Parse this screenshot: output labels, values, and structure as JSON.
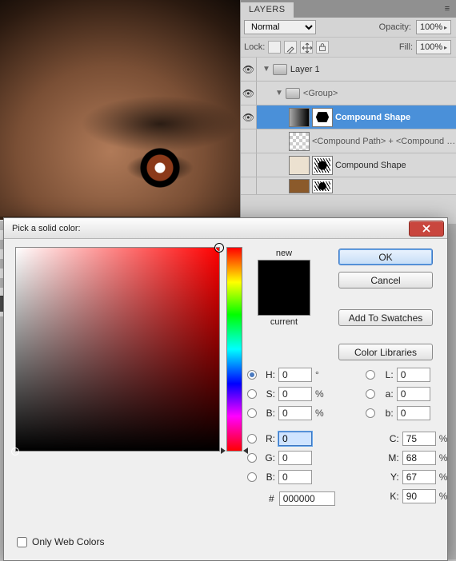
{
  "layers_panel": {
    "tab_label": "LAYERS",
    "blend_mode": "Normal",
    "opacity_label": "Opacity:",
    "opacity_value": "100%",
    "lock_label": "Lock:",
    "fill_label": "Fill:",
    "fill_value": "100%",
    "items": [
      {
        "name": "Layer 1",
        "type": "folder",
        "depth": 0,
        "expanded": true
      },
      {
        "name": "<Group>",
        "type": "folder",
        "depth": 1,
        "expanded": true
      },
      {
        "name": "Compound Shape",
        "type": "shape",
        "depth": 2,
        "selected": true,
        "thumb": "grad",
        "mask": true
      },
      {
        "name": "<Compound Path> + <Compound Path>",
        "type": "shape",
        "depth": 2,
        "thumb": "checker"
      },
      {
        "name": "Compound Shape",
        "type": "shape",
        "depth": 2,
        "thumb": "cream",
        "mask": true
      },
      {
        "name": "",
        "type": "shape",
        "depth": 2,
        "thumb": "brown",
        "mask": true
      }
    ]
  },
  "color_picker": {
    "title": "Pick a solid color:",
    "new_label": "new",
    "current_label": "current",
    "buttons": {
      "ok": "OK",
      "cancel": "Cancel",
      "add_swatch": "Add To Swatches",
      "libraries": "Color Libraries"
    },
    "only_web_label": "Only Web Colors",
    "only_web_checked": false,
    "fields": {
      "H": {
        "value": "0",
        "unit": "°",
        "radio": true,
        "selected": true
      },
      "S": {
        "value": "0",
        "unit": "%",
        "radio": true
      },
      "B": {
        "value": "0",
        "unit": "%",
        "radio": true
      },
      "R": {
        "value": "0",
        "unit": "",
        "radio": true,
        "highlight": true
      },
      "G": {
        "value": "0",
        "unit": "",
        "radio": true
      },
      "B2": {
        "label": "B",
        "value": "0",
        "unit": "",
        "radio": true
      },
      "L": {
        "value": "0",
        "unit": "",
        "radio": true
      },
      "a": {
        "value": "0",
        "unit": "",
        "radio": true
      },
      "b": {
        "value": "0",
        "unit": "",
        "radio": true
      },
      "C": {
        "value": "75",
        "unit": "%"
      },
      "M": {
        "value": "68",
        "unit": "%"
      },
      "Y": {
        "value": "67",
        "unit": "%"
      },
      "K": {
        "value": "90",
        "unit": "%"
      }
    },
    "hex_label": "#",
    "hex_value": "000000"
  }
}
